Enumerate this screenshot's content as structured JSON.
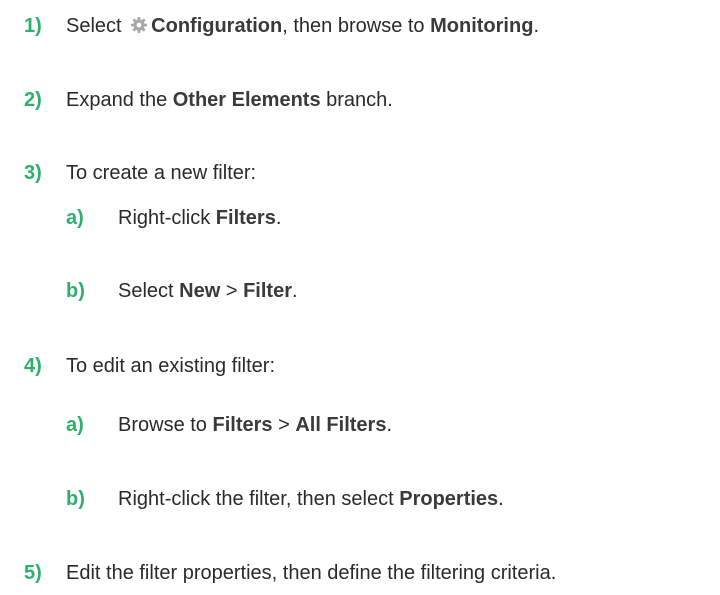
{
  "steps": [
    {
      "num": "1)",
      "parts": [
        "Select ",
        "Configuration",
        ", then browse to ",
        "Monitoring",
        "."
      ]
    },
    {
      "num": "2)",
      "parts": [
        "Expand the ",
        "Other Elements",
        " branch."
      ]
    },
    {
      "num": "3)",
      "text": "To create a new filter:",
      "subs": [
        {
          "num": "a)",
          "parts": [
            "Right-click ",
            "Filters",
            "."
          ]
        },
        {
          "num": "b)",
          "parts": [
            "Select ",
            "New",
            " > ",
            "Filter",
            "."
          ]
        }
      ]
    },
    {
      "num": "4)",
      "text": "To edit an existing filter:",
      "subs": [
        {
          "num": "a)",
          "parts": [
            "Browse to ",
            "Filters",
            " > ",
            "All Filters",
            "."
          ]
        },
        {
          "num": "b)",
          "parts": [
            "Right-click the filter, then select ",
            "Properties",
            "."
          ]
        }
      ]
    },
    {
      "num": "5)",
      "text": "Edit the filter properties, then define the filtering criteria."
    }
  ],
  "icons": {
    "configuration": "gear-icon"
  },
  "colors": {
    "step_number": "#2db06b",
    "text": "#2a2a2a",
    "icon": "#a8a8a8"
  }
}
